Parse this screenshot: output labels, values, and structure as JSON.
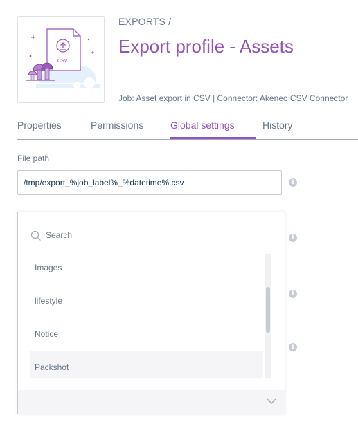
{
  "header": {
    "breadcrumb": "EXPORTS /",
    "title": "Export profile - Assets",
    "job_info": "Job: Asset export in CSV | Connector: Akeneo CSV Connector",
    "thumbnail_file_type": "CSV"
  },
  "tabs": [
    {
      "label": "Properties"
    },
    {
      "label": "Permissions"
    },
    {
      "label": "Global settings"
    },
    {
      "label": "History"
    }
  ],
  "active_tab": "Global settings",
  "fields": {
    "file_path": {
      "label": "File path",
      "value": "/tmp/export_%job_label%_%datetime%.csv"
    }
  },
  "dropdown": {
    "search_placeholder": "Search",
    "items": [
      {
        "label": "Images"
      },
      {
        "label": "lifestyle"
      },
      {
        "label": "Notice"
      },
      {
        "label": "Packshot"
      }
    ]
  },
  "colors": {
    "accent": "#9452ba",
    "text": "#67768a",
    "border": "#c7cbd4",
    "highlight_row": "#f5f5f7"
  },
  "icons": [
    "upload-file-icon",
    "mushroom-illustration",
    "info-icon",
    "search-icon",
    "chevron-down-icon"
  ]
}
